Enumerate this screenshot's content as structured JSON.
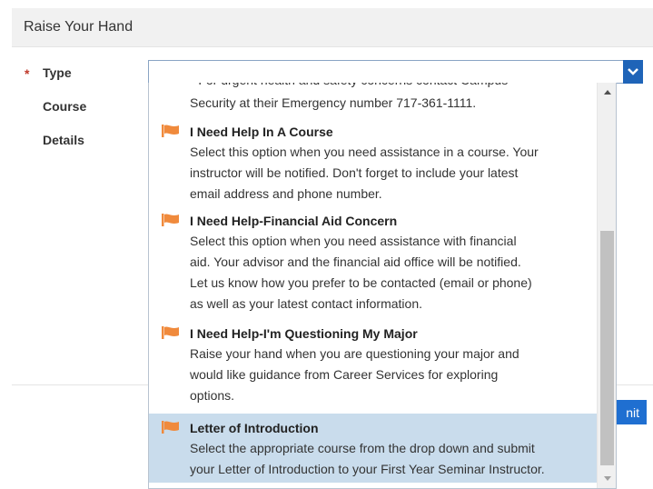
{
  "panel": {
    "title": "Raise Your Hand"
  },
  "form": {
    "required_marker": "*",
    "type_label": "Type",
    "course_label": "Course",
    "details_label": "Details",
    "type_value": ""
  },
  "submit": {
    "label_visible": "nit"
  },
  "dropdown": {
    "partial_top_text_line1": "* For urgent health and safety concerns contact Campus",
    "partial_top_text_line2": "Security at their Emergency number 717-361-1111.",
    "options": [
      {
        "title": "I Need Help In A Course",
        "desc_lines": [
          "Select this option when you need assistance in a course. Your",
          "instructor will be notified. Don't forget to include your latest",
          "email address and phone number."
        ]
      },
      {
        "title": "I Need Help-Financial Aid Concern",
        "desc_lines": [
          "Select this option when you need assistance with financial",
          "aid. Your advisor and the financial aid office will be notified.",
          "Let us know how you prefer to be contacted (email or phone)",
          "as well as your latest contact information."
        ]
      },
      {
        "title": "I Need Help-I'm Questioning My Major",
        "desc_lines": [
          "Raise your hand when you are questioning your major and",
          "would like guidance from Career Services for exploring",
          "options."
        ]
      },
      {
        "title": "Letter of Introduction",
        "desc_lines": [
          "Select the appropriate course from the drop down and submit",
          "your Letter of Introduction to your First Year Seminar Instructor."
        ],
        "selected": true
      }
    ]
  },
  "colors": {
    "flag": "#f08a3c",
    "select_arrow_bg": "#1f64b8",
    "submit_bg": "#1f6fd1",
    "selected_bg": "#c9dcec",
    "required": "#c0392b"
  },
  "icons": {
    "flag": "flag-icon",
    "chevron": "chevron-down-icon",
    "scroll_up": "scroll-up-arrow-icon",
    "scroll_down": "scroll-down-arrow-icon"
  }
}
